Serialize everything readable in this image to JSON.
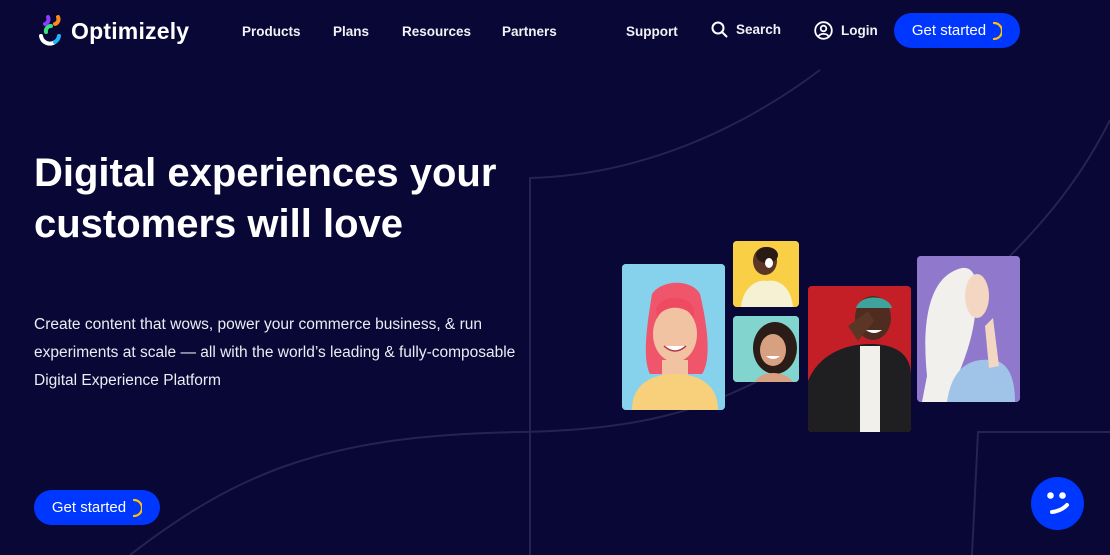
{
  "brand": {
    "name": "Optimizely",
    "colors": {
      "background": "#080736",
      "primary_button": "#0037ff",
      "accent_ring": "#ffc300",
      "logo_purple": "#8a3cff",
      "logo_orange": "#ff8a1c",
      "logo_green": "#3be081",
      "logo_cyan": "#1fb6ff"
    }
  },
  "nav": {
    "items": [
      {
        "label": "Products"
      },
      {
        "label": "Plans"
      },
      {
        "label": "Resources"
      },
      {
        "label": "Partners"
      },
      {
        "label": "Support"
      }
    ],
    "search_label": "Search",
    "login_label": "Login",
    "cta_label": "Get started"
  },
  "hero": {
    "title_line1": "Digital experiences your",
    "title_line2": "customers will love",
    "subtitle": "Create content that wows, power your commerce business, & run experiments at scale — all with the world’s leading & fully-composable Digital Experience Platform",
    "cta_label": "Get started"
  },
  "photos": [
    {
      "alt": "Woman with pink hair smiling on light blue background"
    },
    {
      "alt": "Woman laughing on yellow background"
    },
    {
      "alt": "Woman with curly hair smiling on teal background"
    },
    {
      "alt": "Man laughing with hand over eye on red background"
    },
    {
      "alt": "Woman in white hijab on purple background"
    }
  ],
  "chat": {
    "icon": "smiley-chat-icon"
  }
}
